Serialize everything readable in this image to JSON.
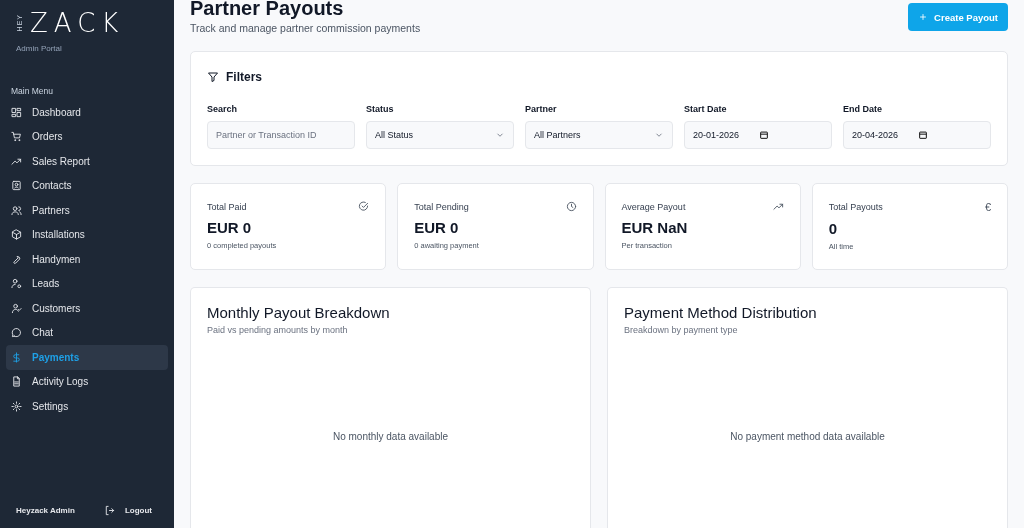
{
  "brand": {
    "prefix": "HEY",
    "name": "ZACK",
    "subtitle": "Admin Portal"
  },
  "sidebar": {
    "section": "Main Menu",
    "items": [
      {
        "label": "Dashboard",
        "selected": false
      },
      {
        "label": "Orders",
        "selected": false
      },
      {
        "label": "Sales Report",
        "selected": false
      },
      {
        "label": "Contacts",
        "selected": false
      },
      {
        "label": "Partners",
        "selected": false
      },
      {
        "label": "Installations",
        "selected": false
      },
      {
        "label": "Handymen",
        "selected": false
      },
      {
        "label": "Leads",
        "selected": false
      },
      {
        "label": "Customers",
        "selected": false
      },
      {
        "label": "Chat",
        "selected": false
      },
      {
        "label": "Payments",
        "selected": true
      },
      {
        "label": "Activity Logs",
        "selected": false
      },
      {
        "label": "Settings",
        "selected": false
      }
    ],
    "user": "Heyzack Admin",
    "logout": "Logout"
  },
  "header": {
    "title": "Partner Payouts",
    "subtitle": "Track and manage partner commission payments",
    "button": "Create Payout"
  },
  "filters": {
    "title": "Filters",
    "fields": [
      {
        "kind": "text",
        "label": "Search",
        "placeholder": "Partner or Transaction ID"
      },
      {
        "kind": "select",
        "label": "Status",
        "value": "All Status"
      },
      {
        "kind": "select",
        "label": "Partner",
        "value": "All Partners"
      },
      {
        "kind": "date",
        "label": "Start Date",
        "value": "20-01-2026"
      },
      {
        "kind": "date",
        "label": "End Date",
        "value": "20-04-2026"
      }
    ]
  },
  "stats": [
    {
      "label": "Total Paid",
      "value": "EUR 0",
      "note": "0 completed payouts"
    },
    {
      "label": "Total Pending",
      "value": "EUR 0",
      "note": "0 awaiting payment"
    },
    {
      "label": "Average Payout",
      "value": "EUR NaN",
      "note": "Per transaction"
    },
    {
      "label": "Total Payouts",
      "value": "0",
      "note": "All time",
      "symbol": "€"
    }
  ],
  "panels": [
    {
      "title": "Monthly Payout Breakdown",
      "subtitle": "Paid vs pending amounts by month",
      "empty": "No monthly data available"
    },
    {
      "title": "Payment Method Distribution",
      "subtitle": "Breakdown by payment type",
      "empty": "No payment method data available"
    }
  ]
}
